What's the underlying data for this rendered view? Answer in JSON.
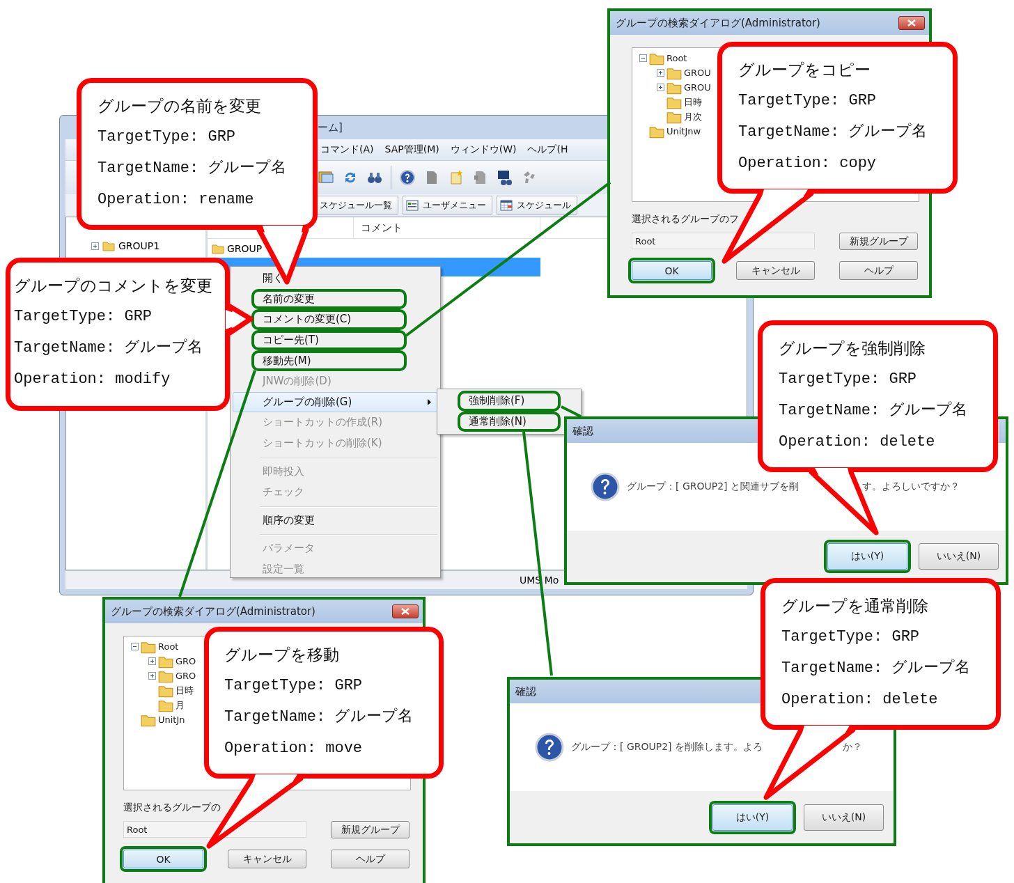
{
  "main_window": {
    "title": "ーム]",
    "menu": [
      "コマンド(A)",
      "SAP管理(M)",
      "ウィンドウ(W)",
      "ヘルプ(H"
    ],
    "tabs": [
      "スケジュール一覧",
      "ユーザメニュー",
      "スケジュール"
    ],
    "tree": [
      {
        "label": "GROUP1",
        "expanded": false
      }
    ],
    "list": {
      "columns": [
        "コメント"
      ],
      "rows": [
        {
          "name": "GROUP",
          "selected": false
        },
        {
          "selected": true
        }
      ]
    },
    "status_bar": "UMS Mo"
  },
  "context_menu": {
    "items": [
      {
        "kind": "item",
        "label": "開く",
        "disabled": false,
        "highlighted": false
      },
      {
        "kind": "item",
        "label": "名前の変更",
        "disabled": false,
        "highlighted": true
      },
      {
        "kind": "item",
        "label": "コメントの変更(C)",
        "disabled": false,
        "highlighted": true
      },
      {
        "kind": "item",
        "label": "コピー先(T)",
        "disabled": false,
        "highlighted": true
      },
      {
        "kind": "item",
        "label": "移動先(M)",
        "disabled": false,
        "highlighted": true
      },
      {
        "kind": "item",
        "label": "JNWの削除(D)",
        "disabled": true,
        "highlighted": false
      },
      {
        "kind": "submenu",
        "label": "グループの削除(G)",
        "disabled": false,
        "highlighted": false,
        "selected": true
      },
      {
        "kind": "item",
        "label": "ショートカットの作成(R)",
        "disabled": true,
        "highlighted": false
      },
      {
        "kind": "item",
        "label": "ショートカットの削除(K)",
        "disabled": true,
        "highlighted": false
      },
      {
        "kind": "separator"
      },
      {
        "kind": "item",
        "label": "即時投入",
        "disabled": true,
        "highlighted": false
      },
      {
        "kind": "item",
        "label": "チェック",
        "disabled": true,
        "highlighted": false
      },
      {
        "kind": "separator"
      },
      {
        "kind": "item",
        "label": "順序の変更",
        "disabled": false,
        "highlighted": false
      },
      {
        "kind": "separator"
      },
      {
        "kind": "item",
        "label": "パラメータ",
        "disabled": true,
        "highlighted": false
      },
      {
        "kind": "item",
        "label": "設定一覧",
        "disabled": true,
        "highlighted": false
      }
    ]
  },
  "submenu": {
    "items": [
      {
        "label": "強制削除(F)",
        "highlighted": true
      },
      {
        "label": "通常削除(N)",
        "highlighted": true
      }
    ]
  },
  "dialogs": [
    {
      "kind": "search",
      "title": "グループの検索ダイアログ(Administrator)",
      "tree": [
        {
          "label": "Root",
          "kind": "branch",
          "expanded": true,
          "children": [
            {
              "label": "GROU",
              "kind": "branch",
              "expanded": false
            },
            {
              "label": "GROU",
              "kind": "branch",
              "expanded": false
            },
            {
              "label": "日時",
              "kind": "leaf"
            },
            {
              "label": "月次",
              "kind": "leaf"
            }
          ]
        },
        {
          "label": "UnitJnw",
          "kind": "leaf"
        }
      ],
      "field_label": "選択されるグループのフ",
      "field_value": "Root",
      "buttons": [
        {
          "label": "新規グループ",
          "highlighted": false
        },
        {
          "label": "OK",
          "highlighted": true
        },
        {
          "label": "キャンセル",
          "highlighted": false
        },
        {
          "label": "ヘルプ",
          "highlighted": false
        }
      ]
    },
    {
      "kind": "confirm",
      "title": "確認",
      "message": [
        "グループ：[ GROUP2] と関連サブを削",
        "す。よろしいですか？"
      ],
      "buttons": [
        {
          "label": "はい(Y)",
          "highlighted": true
        },
        {
          "label": "いいえ(N)",
          "highlighted": false
        }
      ]
    },
    {
      "kind": "search",
      "title": "グループの検索ダイアログ(Administrator)",
      "tree": [
        {
          "label": "Root",
          "kind": "branch",
          "expanded": true,
          "children": [
            {
              "label": "GRO",
              "kind": "branch",
              "expanded": false
            },
            {
              "label": "GRO",
              "kind": "branch",
              "expanded": false
            },
            {
              "label": "日時",
              "kind": "leaf"
            },
            {
              "label": "月",
              "kind": "leaf"
            }
          ]
        },
        {
          "label": "UnitJn",
          "kind": "leaf"
        }
      ],
      "field_label": "選択されるグループの",
      "field_value": "Root",
      "buttons": [
        {
          "label": "新規グループ",
          "highlighted": false
        },
        {
          "label": "OK",
          "highlighted": true
        },
        {
          "label": "キャンセル",
          "highlighted": false
        },
        {
          "label": "ヘルプ",
          "highlighted": false
        }
      ]
    },
    {
      "kind": "confirm",
      "title": "確認",
      "message": [
        "グループ：[ GROUP2] を削除します。よろ",
        "か？"
      ],
      "buttons": [
        {
          "label": "はい(Y)",
          "highlighted": true
        },
        {
          "label": "いいえ(N)",
          "highlighted": false
        }
      ]
    }
  ],
  "callouts": [
    {
      "title": "グループの名前を変更",
      "lines": [
        "TargetType: GRP",
        "TargetName: グループ名",
        "Operation: rename"
      ]
    },
    {
      "title": "グループをコピー",
      "lines": [
        "TargetType: GRP",
        "TargetName: グループ名",
        "Operation: copy"
      ]
    },
    {
      "title": "グループのコメントを変更",
      "lines": [
        "TargetType: GRP",
        "TargetName: グループ名",
        "Operation: modify"
      ]
    },
    {
      "title": "グループを強制削除",
      "lines": [
        "TargetType: GRP",
        "TargetName: グループ名",
        "Operation: delete"
      ]
    },
    {
      "title": "グループを移動",
      "lines": [
        "TargetType: GRP",
        "TargetName: グループ名",
        "Operation: move"
      ]
    },
    {
      "title": "グループを通常削除",
      "lines": [
        "TargetType: GRP",
        "TargetName: グループ名",
        "Operation: delete"
      ]
    }
  ]
}
